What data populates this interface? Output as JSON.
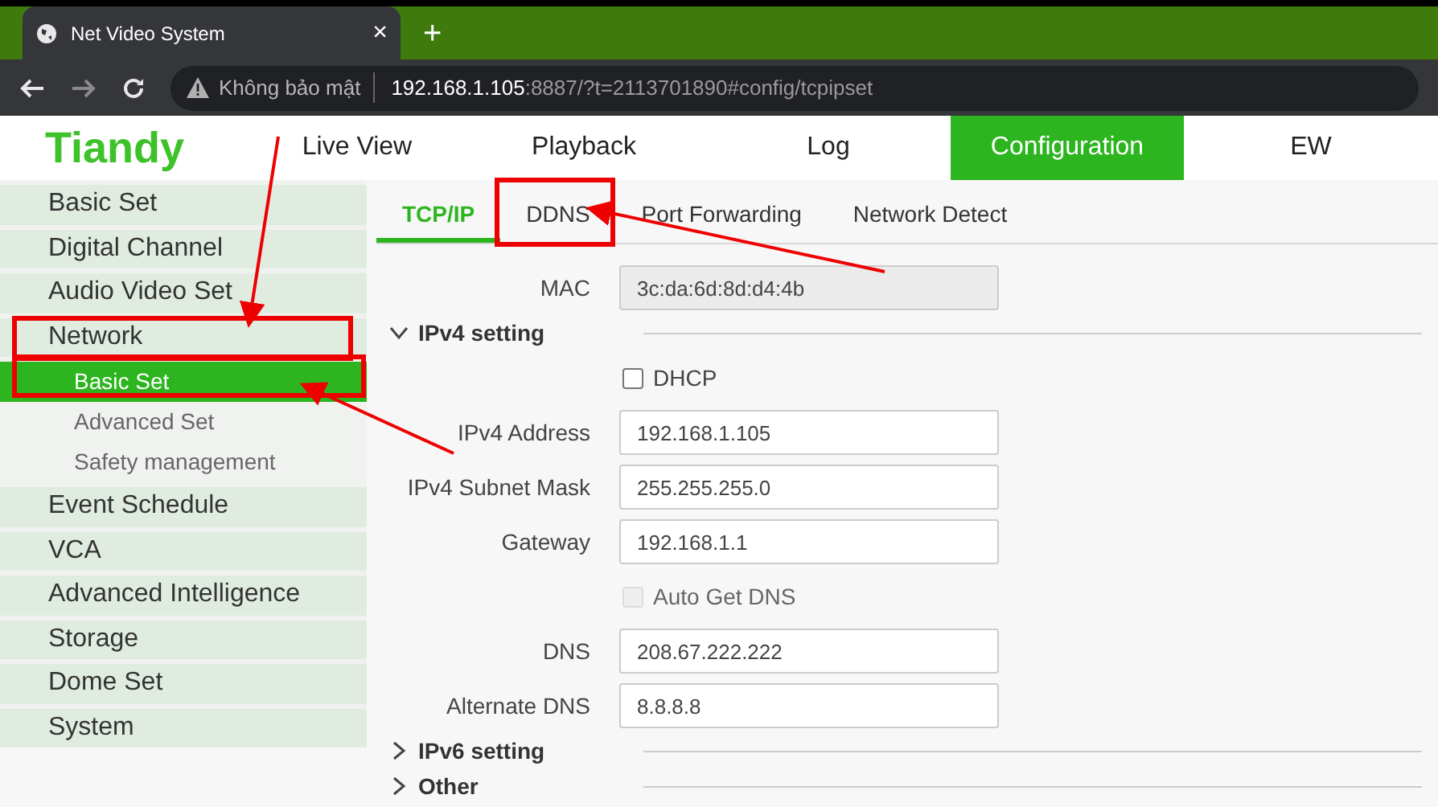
{
  "browser": {
    "tab_title": "Net Video System",
    "close": "×",
    "new_tab": "+",
    "security": "Không bảo mật",
    "url_host": "192.168.1.105",
    "url_rest": ":8887/?t=2113701890#config/tcpipset"
  },
  "logo": "Tiandy",
  "nav": [
    {
      "label": "Live View",
      "selected": false
    },
    {
      "label": "Playback",
      "selected": false
    },
    {
      "label": "Log",
      "selected": false
    },
    {
      "label": "Configuration",
      "selected": true
    },
    {
      "label": "EW",
      "selected": false
    }
  ],
  "sidebar": {
    "items": [
      {
        "label": "Basic Set",
        "selected": false
      },
      {
        "label": "Digital Channel",
        "selected": false
      },
      {
        "label": "Audio Video Set",
        "selected": false
      },
      {
        "label": "Network",
        "selected": false,
        "expanded": true,
        "children": [
          {
            "label": "Basic Set",
            "selected": true
          },
          {
            "label": "Advanced Set",
            "selected": false
          },
          {
            "label": "Safety management",
            "selected": false
          }
        ]
      },
      {
        "label": "Event Schedule",
        "selected": false
      },
      {
        "label": "VCA",
        "selected": false
      },
      {
        "label": "Advanced Intelligence",
        "selected": false
      },
      {
        "label": "Storage",
        "selected": false
      },
      {
        "label": "Dome Set",
        "selected": false
      },
      {
        "label": "System",
        "selected": false
      }
    ]
  },
  "tabs": [
    {
      "label": "TCP/IP",
      "selected": true
    },
    {
      "label": "DDNS",
      "selected": false
    },
    {
      "label": "Port Forwarding",
      "selected": false
    },
    {
      "label": "Network Detect",
      "selected": false
    }
  ],
  "form": [
    {
      "kind": "field",
      "label": "MAC",
      "value": "3c:da:6d:8d:d4:4b",
      "disabled": true
    },
    {
      "kind": "section",
      "label": "IPv4 setting",
      "expanded": true
    },
    {
      "kind": "checkbox",
      "label": "DHCP",
      "checked": false,
      "disabled": false
    },
    {
      "kind": "field",
      "label": "IPv4 Address",
      "value": "192.168.1.105",
      "disabled": false
    },
    {
      "kind": "field",
      "label": "IPv4 Subnet Mask",
      "value": "255.255.255.0",
      "disabled": false
    },
    {
      "kind": "field",
      "label": "Gateway",
      "value": "192.168.1.1",
      "disabled": false
    },
    {
      "kind": "checkbox",
      "label": "Auto Get DNS",
      "checked": false,
      "disabled": true
    },
    {
      "kind": "field",
      "label": "DNS",
      "value": "208.67.222.222",
      "disabled": false
    },
    {
      "kind": "field",
      "label": "Alternate DNS",
      "value": "8.8.8.8",
      "disabled": false
    },
    {
      "kind": "section",
      "label": "IPv6 setting",
      "expanded": false
    },
    {
      "kind": "section",
      "label": "Other",
      "expanded": false
    }
  ]
}
